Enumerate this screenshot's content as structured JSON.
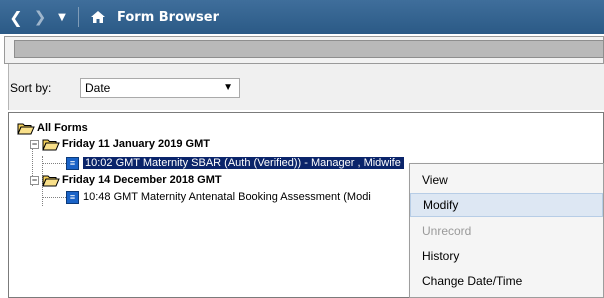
{
  "titlebar": {
    "title": "Form Browser",
    "icons": [
      "back-arrow-icon",
      "forward-arrow-icon",
      "dropdown-icon",
      "home-icon"
    ]
  },
  "sort": {
    "label": "Sort by:",
    "selected": "Date"
  },
  "tree": {
    "root": "All Forms",
    "groups": [
      {
        "date": "Friday 11 January 2019 GMT",
        "items": [
          {
            "label": "10:02 GMT Maternity SBAR (Auth (Verified)) - Manager , Midwife",
            "selected": true
          }
        ]
      },
      {
        "date": "Friday 14 December 2018 GMT",
        "items": [
          {
            "label": "10:48 GMT Maternity Antenatal Booking Assessment (Modi",
            "selected": false
          }
        ]
      }
    ]
  },
  "context_menu": {
    "items": [
      {
        "label": "View",
        "enabled": true,
        "highlighted": false
      },
      {
        "label": "Modify",
        "enabled": true,
        "highlighted": true
      },
      {
        "label": "Unrecord",
        "enabled": false,
        "highlighted": false
      },
      {
        "label": "History",
        "enabled": true,
        "highlighted": false
      },
      {
        "label": "Change Date/Time",
        "enabled": true,
        "highlighted": false
      }
    ]
  },
  "colors": {
    "titlebar": "#2f5f8c",
    "selection": "#0a246a",
    "menu_highlight": "#dde7f3",
    "folder_yellow": "#f6d25b"
  }
}
